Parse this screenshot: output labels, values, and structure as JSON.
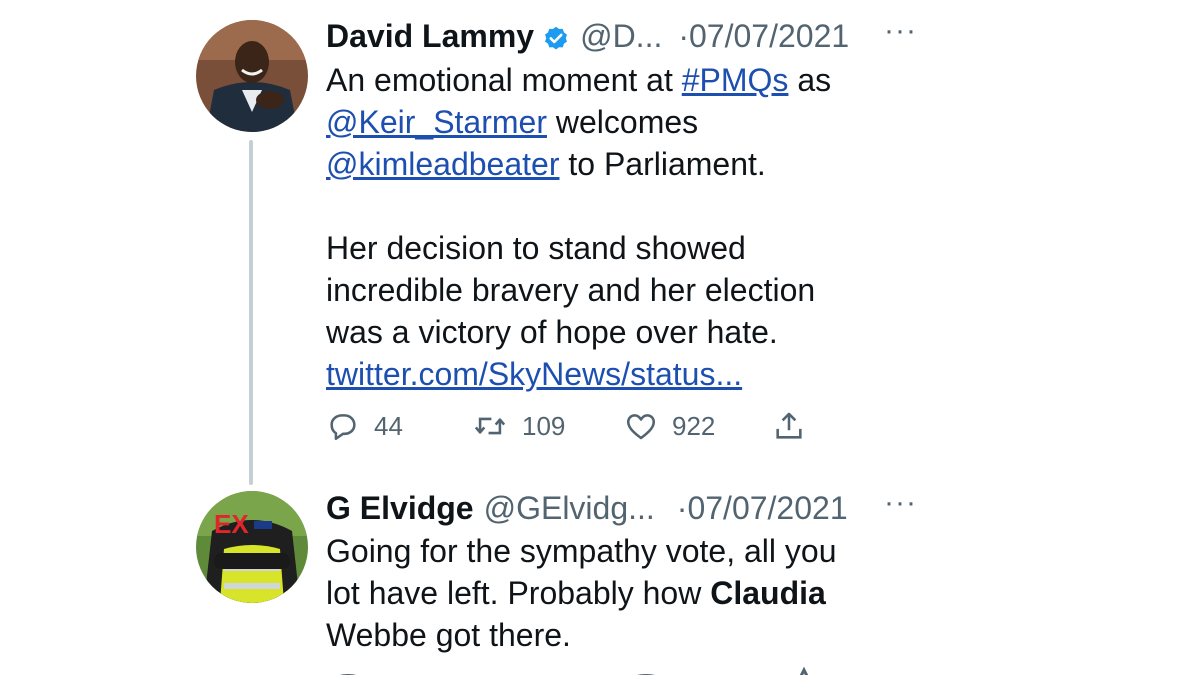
{
  "tweets": [
    {
      "name": "David Lammy",
      "handle": "@D...",
      "date": "·07/07/2021",
      "more": "···",
      "verified": true,
      "text": {
        "p1_a": "An emotional moment at ",
        "hashtag": "#PMQs",
        "p1_b": " as",
        "mention1": "@Keir_Starmer",
        "p1_c": " welcomes",
        "mention2": "@kimleadbeater",
        "p1_d": " to Parliament.",
        "p2": "Her decision to stand showed\nincredible bravery and her election\nwas a victory of hope over hate.",
        "link": "twitter.com/SkyNews/status..."
      },
      "stats": {
        "replies": "44",
        "retweets": "109",
        "likes": "922"
      }
    },
    {
      "name": "G Elvidge",
      "handle": "@GElvidg...",
      "date": "·07/07/2021",
      "more": "···",
      "verified": false,
      "text": {
        "a": "Going for the sympathy vote, all you\nlot have left. Probably how ",
        "bold": "Claudia",
        "b": "\nWebbe got there."
      }
    }
  ],
  "icons": {
    "reply": "reply-icon",
    "retweet": "retweet-icon",
    "like": "heart-icon",
    "share": "share-icon",
    "verified": "verified-badge-icon"
  },
  "colors": {
    "link": "#1d4fb0",
    "secondary": "#536471",
    "verified": "#1d9bf0",
    "thread_line": "#c4cfd6"
  }
}
